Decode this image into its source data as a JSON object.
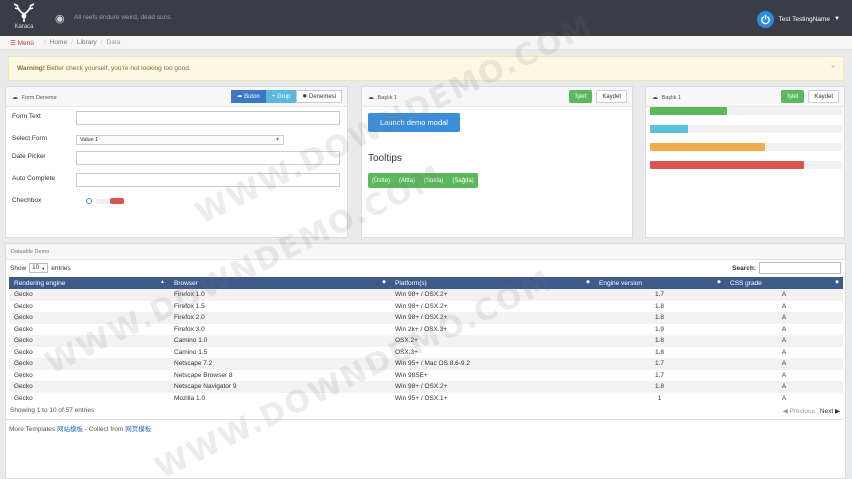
{
  "topnav": {
    "logo_text": "Karaca",
    "quote": "All reefs endure weird, dead suns.",
    "user_name": "Test TestingName"
  },
  "breadcrumb": {
    "menu": "Menü",
    "items": [
      "Home",
      "Library",
      "Data"
    ]
  },
  "alert": {
    "strong": "Warning!",
    "text": " Better check yourself, you're not looking too good.",
    "close": "×"
  },
  "form_panel": {
    "title": "Form Deneme",
    "buttons": [
      "Buton",
      "Grup",
      "Denemesi"
    ],
    "fields": {
      "form_text_label": "Form Text",
      "select_form_label": "Select Form",
      "select_value": "Value 1",
      "date_picker_label": "Date Picker",
      "auto_complete_label": "Auto Complete",
      "checkbox_label": "Chechbox"
    }
  },
  "middle_panel": {
    "title": "Başlık 1",
    "btn_primary": "İşlet",
    "btn_secondary": "Kaydet",
    "launch_label": "Launch demo modal",
    "tooltips_title": "Tooltips",
    "tooltip_items": [
      "(Üstte)",
      "(Altta)",
      "(Solda)",
      "(Sağda)"
    ]
  },
  "right_panel": {
    "title": "Başlık 1",
    "btn_primary": "İşlet",
    "btn_secondary": "Kaydet",
    "progress": [
      {
        "value": 40,
        "color": "#5cb85c"
      },
      {
        "value": 20,
        "color": "#5bc0de"
      },
      {
        "value": 60,
        "color": "#f0ad4e"
      },
      {
        "value": 80,
        "color": "#d9534f"
      }
    ]
  },
  "datatable": {
    "title": "Dataable Demo",
    "show_label": "Show",
    "length_value": "10",
    "entries_label": "entries",
    "search_label": "Search:",
    "columns": [
      "Rendering engine",
      "Browser",
      "Platform(s)",
      "Engine version",
      "CSS grade"
    ],
    "rows": [
      [
        "Gecko",
        "Firefox 1.0",
        "Win 98+ / OSX.2+",
        "1.7",
        "A"
      ],
      [
        "Gecko",
        "Firefox 1.5",
        "Win 98+ / OSX.2+",
        "1.8",
        "A"
      ],
      [
        "Gecko",
        "Firefox 2.0",
        "Win 98+ / OSX.2+",
        "1.8",
        "A"
      ],
      [
        "Gecko",
        "Firefox 3.0",
        "Win 2k+ / OSX.3+",
        "1.9",
        "A"
      ],
      [
        "Gecko",
        "Camino 1.0",
        "OSX.2+",
        "1.8",
        "A"
      ],
      [
        "Gecko",
        "Camino 1.5",
        "OSX.3+",
        "1.8",
        "A"
      ],
      [
        "Gecko",
        "Netscape 7.2",
        "Win 95+ / Mac OS 8.6-9.2",
        "1.7",
        "A"
      ],
      [
        "Gecko",
        "Netscape Browser 8",
        "Win 98SE+",
        "1.7",
        "A"
      ],
      [
        "Gecko",
        "Netscape Navigator 9",
        "Win 98+ / OSX.2+",
        "1.8",
        "A"
      ],
      [
        "Gecko",
        "Mozilla 1.0",
        "Win 95+ / OSX.1+",
        "1",
        "A"
      ]
    ],
    "info": "Showing 1 to 10 of 57 entries",
    "prev": "◀ Previous",
    "next": "Next ▶"
  },
  "footer": {
    "prefix": "More Templates ",
    "link1": "网站模板",
    "middle": " - Collect from ",
    "link2": "网页模板"
  },
  "watermark": "WWW.DOWNDEMO.COM"
}
